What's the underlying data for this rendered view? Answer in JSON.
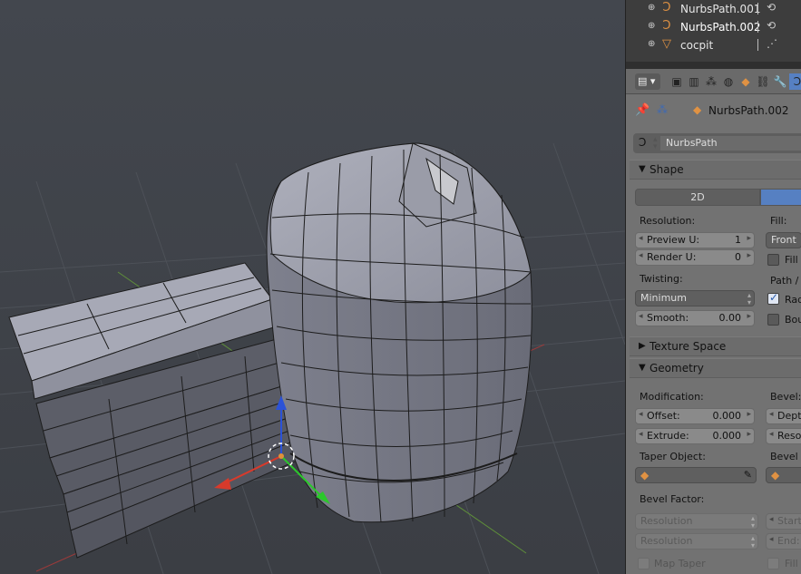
{
  "outliner": {
    "items": [
      {
        "name": "NurbsPath.001",
        "expand_icon": "⊕",
        "obj_icon": "curve-icon",
        "data_icon": "curve-data-icon"
      },
      {
        "name": "NurbsPath.002",
        "expand_icon": "⊕",
        "obj_icon": "curve-icon",
        "data_icon": "curve-data-icon"
      },
      {
        "name": "cocpit",
        "expand_icon": "⊕",
        "obj_icon": "mesh-icon",
        "data_icon": "mesh-data-icon"
      }
    ]
  },
  "properties": {
    "context_object": "NurbsPath.002",
    "datablock_name": "NurbsPath",
    "shape": {
      "title": "Shape",
      "mode_2d": "2D",
      "resolution_label": "Resolution:",
      "preview_u_label": "Preview U:",
      "preview_u_value": "1",
      "render_u_label": "Render U:",
      "render_u_value": "0",
      "twisting_label": "Twisting:",
      "twisting_value": "Minimum",
      "smooth_label": "Smooth:",
      "smooth_value": "0.00",
      "fill_label": "Fill:",
      "fill_value": "Front",
      "fill_check_label": "Fill",
      "path_label": "Path / C",
      "radius_check_label": "Rad",
      "bounds_check_label": "Bou"
    },
    "texture_space": {
      "title": "Texture Space"
    },
    "geometry": {
      "title": "Geometry",
      "modification_label": "Modification:",
      "offset_label": "Offset:",
      "offset_value": "0.000",
      "extrude_label": "Extrude:",
      "extrude_value": "0.000",
      "taper_label": "Taper Object:",
      "bevel_label": "Bevel:",
      "depth_label": "Depth",
      "resol_label": "Resol",
      "bevel_obj_label": "Bevel O",
      "bevel_factor_label": "Bevel Factor:",
      "resolution_a": "Resolution",
      "resolution_b": "Resolution",
      "start_label": "Start:",
      "end_label": "End:",
      "map_taper_label": "Map Taper",
      "fill_caps_label": "Fill"
    }
  },
  "colors": {
    "viewport_bg": "#3d4147",
    "panel_bg": "#727272",
    "accent_blue": "#5680c2",
    "object_orange": "#e09243"
  }
}
